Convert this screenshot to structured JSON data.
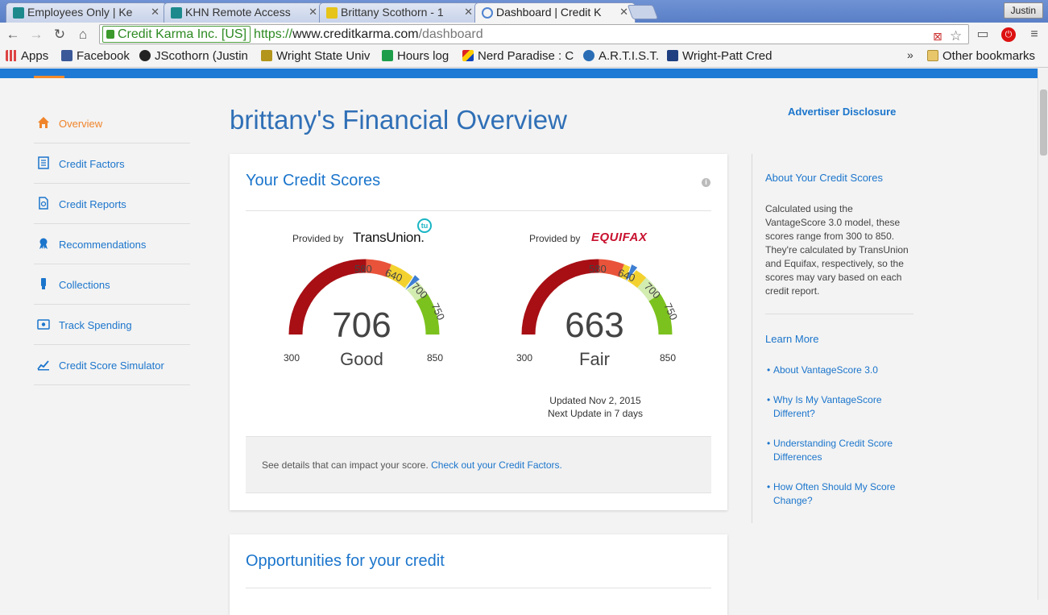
{
  "browser": {
    "tabs": [
      {
        "title": "Employees Only | Ke",
        "active": false
      },
      {
        "title": "KHN Remote Access",
        "active": false
      },
      {
        "title": "Brittany Scothorn - 1",
        "active": false
      },
      {
        "title": "Dashboard | Credit K",
        "active": true
      }
    ],
    "profile": "Justin",
    "ev_name": "Credit Karma Inc. [US]",
    "url_scheme": "https://",
    "url_host": "www.creditkarma.com",
    "url_path": "/dashboard",
    "bookmarks": [
      {
        "label": "Apps",
        "icon": "apps-grid-icon",
        "color": "#d44"
      },
      {
        "label": "Facebook",
        "icon": "facebook-icon",
        "color": "#3b5998"
      },
      {
        "label": "JScothorn (Justin",
        "icon": "github-icon",
        "color": "#222"
      },
      {
        "label": "Wright State Univ",
        "icon": "wsu-icon",
        "color": "#7a6a1a"
      },
      {
        "label": "Hours log",
        "icon": "sheets-icon",
        "color": "#1e9e4a"
      },
      {
        "label": "Nerd Paradise : C",
        "icon": "nerd-paradise-icon",
        "color": "#c33"
      },
      {
        "label": "A.R.T.I.S.T.",
        "icon": "artist-icon",
        "color": "#2a6db5"
      },
      {
        "label": "Wright-Patt Cred",
        "icon": "wright-patt-icon",
        "color": "#1f3f80"
      }
    ],
    "bookmarks_more": "»",
    "other_bookmarks": "Other bookmarks"
  },
  "sidenav": [
    {
      "label": "Overview",
      "icon": "home-icon",
      "active": true
    },
    {
      "label": "Credit Factors",
      "icon": "checklist-icon",
      "active": false
    },
    {
      "label": "Credit Reports",
      "icon": "report-icon",
      "active": false
    },
    {
      "label": "Recommendations",
      "icon": "ribbon-icon",
      "active": false
    },
    {
      "label": "Collections",
      "icon": "phone-icon",
      "active": false
    },
    {
      "label": "Track Spending",
      "icon": "wallet-icon",
      "active": false
    },
    {
      "label": "Credit Score Simulator",
      "icon": "chart-icon",
      "active": false
    }
  ],
  "page": {
    "title": "brittany's Financial Overview",
    "advertiser_disclosure": "Advertiser Disclosure"
  },
  "scores_card": {
    "title": "Your Credit Scores",
    "info": "i",
    "provided_by": "Provided by",
    "gauges": [
      {
        "provider": "TransUnion",
        "provider_suffix": ".",
        "score": "706",
        "band": "Good",
        "value": 706,
        "min": "300",
        "max": "850",
        "ticks": [
          "580",
          "640",
          "700",
          "750"
        ]
      },
      {
        "provider": "EQUIFAX",
        "score": "663",
        "band": "Fair",
        "value": 663,
        "min": "300",
        "max": "850",
        "ticks": [
          "580",
          "640",
          "700",
          "750"
        ]
      }
    ],
    "tu_badge": "tu",
    "updated": "Updated Nov 2, 2015",
    "next_update": "Next Update in 7 days",
    "factors_text": "See details that can impact your score.",
    "factors_link": "Check out your Credit Factors."
  },
  "opportunities_card": {
    "title": "Opportunities for your credit"
  },
  "rail": {
    "about_title": "About Your Credit Scores",
    "about_text": "Calculated using the VantageScore 3.0 model, these scores range from 300 to 850. They're calculated by TransUnion and Equifax, respectively, so the scores may vary based on each credit report.",
    "learn_more": "Learn More",
    "links": [
      "About VantageScore 3.0",
      "Why Is My VantageScore Different?",
      "Understanding Credit Score Differences",
      "How Often Should My Score Change?"
    ]
  },
  "colors": {
    "brand_blue": "#1f7ad6",
    "link_blue": "#1b75cc",
    "active_orange": "#f0842a",
    "gauge_bands": [
      "#a70f14",
      "#e8533a",
      "#f3d230",
      "#d3ecb0",
      "#7cc21e"
    ]
  }
}
